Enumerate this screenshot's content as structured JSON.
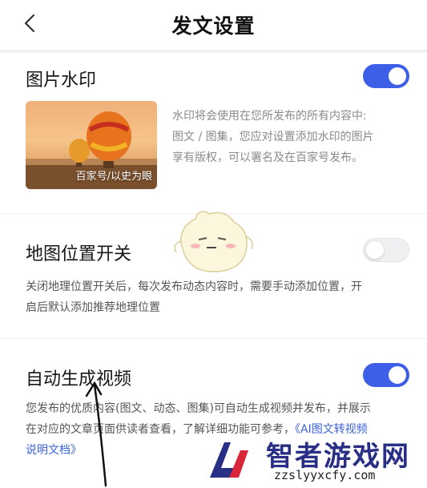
{
  "header": {
    "title": "发文设置"
  },
  "watermark_setting": {
    "label": "图片水印",
    "enabled": true,
    "description_lines": [
      "水印将会使用在您所发布的所有内容中:",
      "图文 / 图集，您应对设置添加水印的图片",
      "享有版权，可以署名及在百家号发布。"
    ],
    "preview_caption": "百家号/以史为眼"
  },
  "map_setting": {
    "label": "地图位置开关",
    "enabled": false,
    "description_lines": [
      "关闭地理位置开关后，每次发布动态内容时，需要手动添加位置，开",
      "启后默认添加推荐地理位置"
    ]
  },
  "video_setting": {
    "label": "自动生成视频",
    "enabled": true,
    "description_line1": "您发布的优质内容(图文、动态、图集)可自动生成视频并发布，并展示",
    "description_line2": "在对应的文章页面供读者查看，了解详细功能可参考，",
    "link_part1": "《AI图文转视频",
    "link_part2": "说明文档》"
  },
  "site_watermark": {
    "name": "智者游戏网",
    "url": "zzslyyxcfy.com"
  },
  "colors": {
    "accent": "#3d5ee6",
    "link": "#3b62d9"
  },
  "icons": {
    "back": "chevron-left-icon"
  }
}
